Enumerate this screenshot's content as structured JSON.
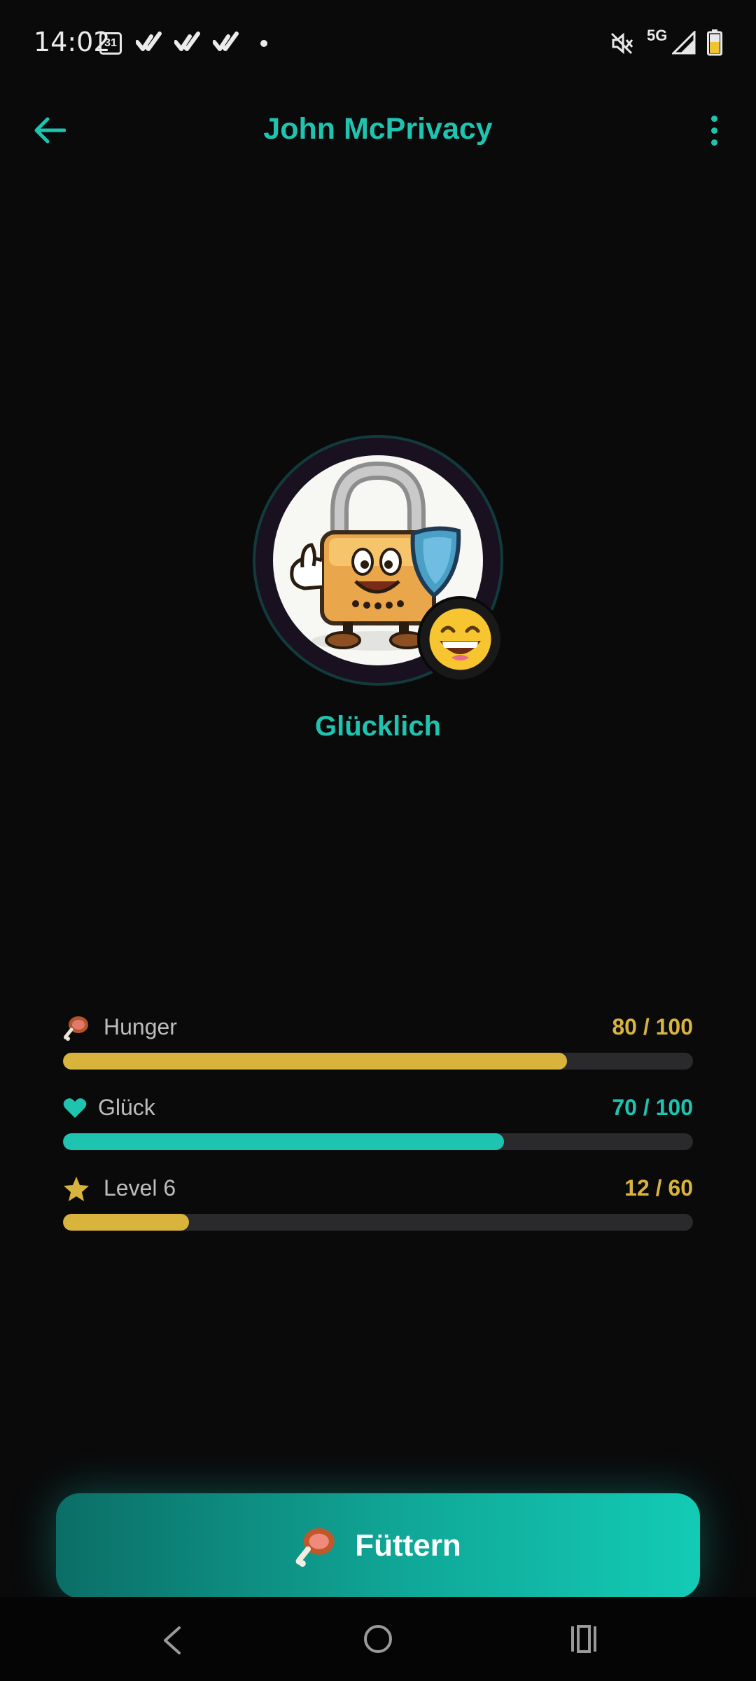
{
  "status_bar": {
    "time": "14:02",
    "calendar_day": "31",
    "network": "5G",
    "icons": [
      "calendar-icon",
      "check-icon",
      "check-icon",
      "check-icon",
      "dot-icon",
      "mute-icon",
      "signal-icon",
      "battery-icon"
    ]
  },
  "app_bar": {
    "title": "John McPrivacy",
    "back_icon": "arrow-left-icon",
    "menu_icon": "more-vert-icon"
  },
  "pet": {
    "mood_label": "Glücklich",
    "mood_emoji": "😄",
    "avatar": "padlock-mascot-with-shield"
  },
  "stats": {
    "hunger": {
      "label": "Hunger",
      "value_text": "80 / 100",
      "value": 80,
      "max": 100,
      "icon": "meat-icon"
    },
    "happiness": {
      "label": "Glück",
      "value_text": "70 / 100",
      "value": 70,
      "max": 100,
      "icon": "heart-icon"
    },
    "level": {
      "label": "Level 6",
      "value_text": "12 / 60",
      "value": 12,
      "max": 60,
      "icon": "star-icon"
    }
  },
  "feed_button": {
    "label": "Füttern",
    "icon": "meat-icon"
  },
  "colors": {
    "accent": "#1fc4b0",
    "gold": "#d9b43c",
    "background": "#0a0a0b",
    "track": "#2a2a2c"
  },
  "nav_bar": {
    "icons": [
      "back-nav-icon",
      "home-nav-icon",
      "recents-nav-icon"
    ]
  }
}
